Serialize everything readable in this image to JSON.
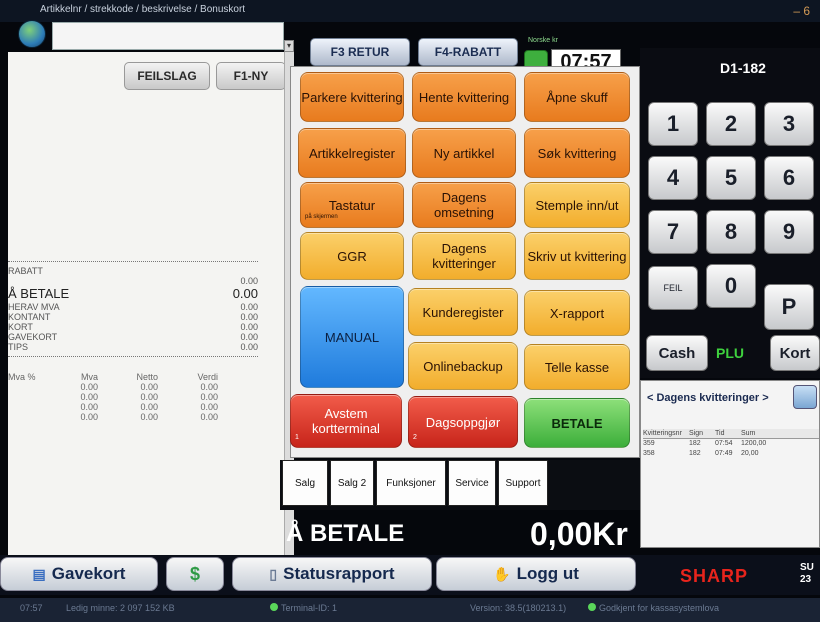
{
  "topbar": {
    "label": "Artikkelnr / strekkode / beskrivelse / Bonuskort",
    "minimize": "– 6"
  },
  "left": {
    "feilslag": "FEILSLAG",
    "f1ny": "F1-NY",
    "totals": [
      {
        "label": "RABATT",
        "value": ""
      },
      {
        "label": "Å BETALE",
        "value": "0.00",
        "big": true,
        "sub": "0.00"
      },
      {
        "label": "HERAV MVA",
        "value": "0.00"
      },
      {
        "label": "KONTANT",
        "value": "0.00"
      },
      {
        "label": "KORT",
        "value": "0.00"
      },
      {
        "label": "GAVEKORT",
        "value": "0.00"
      },
      {
        "label": "TIPS",
        "value": "0.00"
      }
    ],
    "mva_headers": [
      "Mva %",
      "Mva",
      "Netto",
      "Verdi"
    ],
    "mva_rows": [
      [
        "",
        "0.00",
        "0.00",
        "0.00"
      ],
      [
        "",
        "0.00",
        "0.00",
        "0.00"
      ],
      [
        "",
        "0.00",
        "0.00",
        "0.00"
      ],
      [
        "",
        "0.00",
        "0.00",
        "0.00"
      ]
    ]
  },
  "toolbar": {
    "retur": "F3 RETUR",
    "rabatt": "F4-RABATT",
    "lang": "Norske kr",
    "clock": "07:57"
  },
  "buttons": {
    "parkere": "Parkere kvittering",
    "hente": "Hente kvittering",
    "apne": "Åpne skuff",
    "artreg": "Artikkelregister",
    "nyart": "Ny artikkel",
    "sok": "Søk kvittering",
    "tastatur": "Tastatur",
    "tastatur_sub": "på skjermen",
    "dagoms": "Dagens omsetning",
    "stemple": "Stemple inn/ut",
    "ggr": "GGR",
    "dagkv": "Dagens kvitteringer",
    "skriv": "Skriv ut kvittering",
    "manual": "MANUAL",
    "kundereg": "Kunderegister",
    "xrapport": "X-rapport",
    "online": "Onlinebackup",
    "telle": "Telle kasse",
    "avstem": "Avstem kortterminal",
    "avstem_num": "1",
    "dagsopp": "Dagsoppgjør",
    "dagsopp_num": "2",
    "betale": "BETALE"
  },
  "tabs": [
    "Salg",
    "Salg 2",
    "Funksjoner",
    "Service",
    "Support"
  ],
  "total": {
    "label": "Å BETALE",
    "amount": "0,00Kr"
  },
  "keypad": {
    "terminal": "D1-182",
    "keys": [
      "1",
      "2",
      "3",
      "4",
      "5",
      "6",
      "7",
      "8",
      "9"
    ],
    "feil": "FEIL",
    "zero": "0",
    "p": "P",
    "cash": "Cash",
    "plu": "PLU",
    "kort": "Kort"
  },
  "dagens": {
    "title": "< Dagens kvitteringer >",
    "headers": [
      "Kvitteringsnr",
      "Sign",
      "Tid",
      "Sum"
    ],
    "rows": [
      [
        "359",
        "182",
        "07:54",
        "1200,00"
      ],
      [
        "358",
        "182",
        "07:49",
        "20,00"
      ]
    ]
  },
  "bottom": {
    "gavekort": "Gavekort",
    "status": "Statusrapport",
    "logg": "Logg ut",
    "sharp": "SHARP",
    "su1": "SU",
    "su2": "23"
  },
  "statusbar": {
    "time": "07:57",
    "mem": "Ledig minne: 2 097 152 KB",
    "terminal": "Terminal-ID: 1",
    "version": "Version: 38.5(180213.1)",
    "approved": "Godkjent for kassasystemlova"
  },
  "colors": {
    "orange": "#e87b1e",
    "yellow": "#f2ad2c",
    "blue": "#1f7bdc",
    "red": "#c7241a",
    "green": "#3cae3a",
    "sharp": "#e8241c"
  }
}
